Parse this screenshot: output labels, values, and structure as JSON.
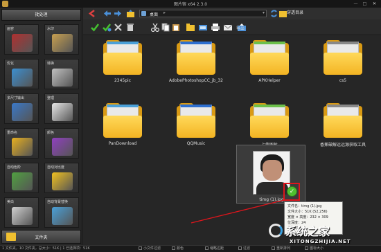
{
  "window": {
    "title": "图片宿 x64 2.3.0",
    "min": "—",
    "max": "□",
    "close": "✕"
  },
  "left_panel": {
    "header": "批处理",
    "tools": [
      {
        "label": "画容",
        "icon": "cosmetics-icon",
        "color": "#b03030"
      },
      {
        "label": "水印",
        "icon": "watermark-icon",
        "color": "#c8a050"
      },
      {
        "label": "优化",
        "icon": "optimize-icon",
        "color": "#3c8fd0"
      },
      {
        "label": "转换",
        "icon": "convert-icon",
        "color": "#c0c0c0"
      },
      {
        "label": "多尺寸输出",
        "icon": "multi-size-icon",
        "color": "#3a78c8"
      },
      {
        "label": "整理",
        "icon": "organize-icon",
        "color": "#e6e6e6"
      },
      {
        "label": "重命名",
        "icon": "rename-icon",
        "color": "#e8b020"
      },
      {
        "label": "颜色",
        "icon": "color-icon",
        "color": "#9040c0"
      },
      {
        "label": "自动色阶",
        "icon": "auto-levels-icon",
        "color": "#50a040"
      },
      {
        "label": "自动对比度",
        "icon": "auto-contrast-icon",
        "color": "#f0c020"
      },
      {
        "label": "美白",
        "icon": "whitening-icon",
        "color": "#d0d0d0"
      },
      {
        "label": "自动背景替换",
        "icon": "background-replace-icon",
        "color": "#4aa0d8"
      }
    ],
    "folder_button": "文件夹"
  },
  "toolbar": {
    "path": "桌面",
    "path_arrow": "▸",
    "path_dropdown": "▾",
    "dir_button": "穿透目录",
    "export": "导出"
  },
  "folders": [
    {
      "name": "2345pic"
    },
    {
      "name": "AdobePhotoshopCC_jb_32"
    },
    {
      "name": "APKHelper"
    },
    {
      "name": "cs5"
    },
    {
      "name": "PanDownload"
    },
    {
      "name": "QQMusic"
    },
    {
      "name": "上传图片"
    },
    {
      "name": "香蕉破解远远源获取工具"
    }
  ],
  "selected_image": {
    "name": "timg (1).jpg",
    "check": "✓"
  },
  "tooltip": {
    "lines": [
      "文件名：timg (1).jpg",
      "文件大小：51K (52,256)",
      "宽度 × 高度：232 × 309",
      "位深度：24",
      "修改时..."
    ]
  },
  "status": {
    "text": "1 文件夹，10 文件夹，总大小：51K | 1 已选择项：51K",
    "options": [
      "小文件过滤",
      "颜色",
      "缩略边距",
      "过滤",
      "重新排列",
      "图标大小"
    ]
  },
  "watermark": {
    "brand": "系统之家",
    "url": "XITONGZHIJIA.NET"
  }
}
